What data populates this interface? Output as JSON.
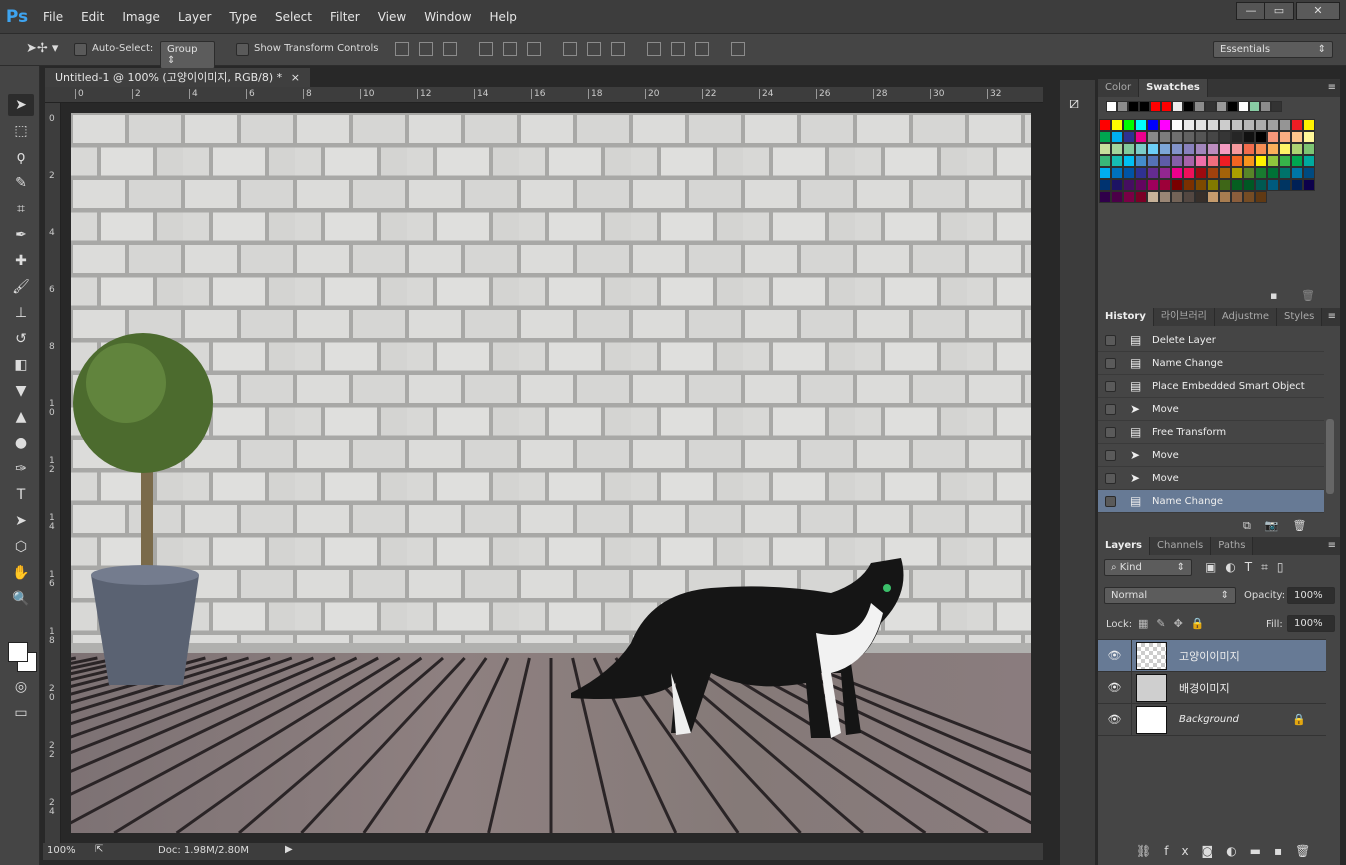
{
  "app": {
    "logo": "Ps",
    "menus": [
      "File",
      "Edit",
      "Image",
      "Layer",
      "Type",
      "Select",
      "Filter",
      "View",
      "Window",
      "Help"
    ],
    "window_controls": [
      "minimize",
      "maximize",
      "close"
    ]
  },
  "options": {
    "auto_select_label": "Auto-Select:",
    "auto_select_value": "Group",
    "transform_label": "Show Transform Controls",
    "workspace": "Essentials"
  },
  "document": {
    "tab_title": "Untitled-1 @ 100% (고양이이미지, RGB/8) *",
    "close": "×",
    "zoom": "100%",
    "doc_info": "Doc: 1.98M/2.80M"
  },
  "rulers": {
    "top": [
      "0",
      "2",
      "4",
      "6",
      "8",
      "10",
      "12",
      "14",
      "16",
      "18",
      "20",
      "22",
      "24",
      "26",
      "28",
      "30",
      "32"
    ],
    "left": [
      "0",
      "2",
      "4",
      "6",
      "8",
      "10",
      "12",
      "14",
      "16",
      "18",
      "20",
      "22",
      "24"
    ]
  },
  "tools": [
    "move",
    "rect-marquee",
    "lasso",
    "quick-select",
    "crop",
    "eyedropper",
    "healing-brush",
    "brush",
    "clone-stamp",
    "history-brush",
    "eraser",
    "paint-bucket",
    "blur",
    "dodge",
    "pen",
    "type",
    "path-selection",
    "shape",
    "hand",
    "zoom"
  ],
  "swatches_panel": {
    "tabs": [
      "Color",
      "Swatches"
    ],
    "recent": [
      "#ffffff",
      "#8c8c8c",
      "#000000",
      "#000000",
      "#ff0000",
      "#ff0000",
      "#ebebeb",
      "#000000",
      "#8c8c8c",
      "#333333",
      "#999999",
      "#000000",
      "#ffffff",
      "#88cca4",
      "#8c8c8c",
      "#333333"
    ],
    "grid": [
      [
        "#ff0000",
        "#ffff00",
        "#00ff00",
        "#00ffff",
        "#0000ff",
        "#ff00ff",
        "#ffffff",
        "#ebebeb",
        "#e1e1e1",
        "#d7d7d7",
        "#cccccc",
        "#c2c2c2",
        "#b7b7b7",
        "#acacac",
        "#a0a0a0",
        "#959595",
        "#ee1d24",
        "#fff100"
      ],
      [
        "#00a650",
        "#00aeef",
        "#2e3192",
        "#ec008c",
        "#898989",
        "#7d7d7d",
        "#707070",
        "#626262",
        "#555555",
        "#464646",
        "#363636",
        "#262626",
        "#111111",
        "#000000",
        "#f7977a",
        "#fbad82",
        "#fdc68c",
        "#fff799"
      ],
      [
        "#c6df9c",
        "#a4d49d",
        "#81ca9d",
        "#7bcdc9",
        "#6ccff7",
        "#7ca6d8",
        "#8293ca",
        "#8881be",
        "#a286bd",
        "#bc8cbf",
        "#f49bc1",
        "#f5999d",
        "#f16c4d",
        "#f68e54",
        "#fbaf5a",
        "#fff467",
        "#acd372",
        "#7dc473"
      ],
      [
        "#39b778",
        "#16bcb4",
        "#00bff3",
        "#438ccb",
        "#5573b7",
        "#5e5ca7",
        "#855fa8",
        "#a763a9",
        "#ef6ea8",
        "#f16d7e",
        "#ee1d24",
        "#f16522",
        "#f7941d",
        "#fff100",
        "#8fc63d",
        "#37b44a",
        "#00a650",
        "#00a99e"
      ],
      [
        "#00aeef",
        "#0072bc",
        "#0054a5",
        "#2f3192",
        "#652c91",
        "#91278f",
        "#ed008c",
        "#ee105a",
        "#9d0a0f",
        "#a1410d",
        "#a36209",
        "#aba000",
        "#588528",
        "#197b30",
        "#007236",
        "#00736a",
        "#0076a4",
        "#004a80"
      ],
      [
        "#003370",
        "#1d1363",
        "#450e61",
        "#62055f",
        "#9e005c",
        "#9d0039",
        "#790000",
        "#7b3000",
        "#7c4900",
        "#827a00",
        "#3e6617",
        "#045f20",
        "#005824",
        "#005951",
        "#005b7e",
        "#003562",
        "#002056",
        "#0c004b"
      ],
      [
        "#30004a",
        "#4b0048",
        "#7a0045",
        "#7a0026",
        "#c7b299",
        "#998675",
        "#736357",
        "#534741",
        "#372f2a",
        "#c69c6d",
        "#a77c50",
        "#8b5e3c",
        "#754c24",
        "#603913"
      ]
    ]
  },
  "history_panel": {
    "tabs": [
      "History",
      "라이브러리",
      "Adjustme",
      "Styles"
    ],
    "items": [
      {
        "label": "Delete Layer",
        "icon": "doc"
      },
      {
        "label": "Name Change",
        "icon": "doc"
      },
      {
        "label": "Place Embedded Smart Object",
        "icon": "doc"
      },
      {
        "label": "Move",
        "icon": "move"
      },
      {
        "label": "Free Transform",
        "icon": "doc"
      },
      {
        "label": "Move",
        "icon": "move"
      },
      {
        "label": "Move",
        "icon": "move"
      },
      {
        "label": "Name Change",
        "icon": "doc",
        "selected": true
      }
    ]
  },
  "layers_panel": {
    "tabs": [
      "Layers",
      "Channels",
      "Paths"
    ],
    "filter": "Kind",
    "blend": "Normal",
    "opacity_label": "Opacity:",
    "opacity": "100%",
    "lock_label": "Lock:",
    "fill_label": "Fill:",
    "fill": "100%",
    "layers": [
      {
        "name": "고양이이미지",
        "selected": true,
        "italic": false
      },
      {
        "name": "배경이미지",
        "selected": false,
        "italic": false
      },
      {
        "name": "Background",
        "selected": false,
        "italic": true,
        "locked": true
      }
    ]
  },
  "accent": "#677a95"
}
